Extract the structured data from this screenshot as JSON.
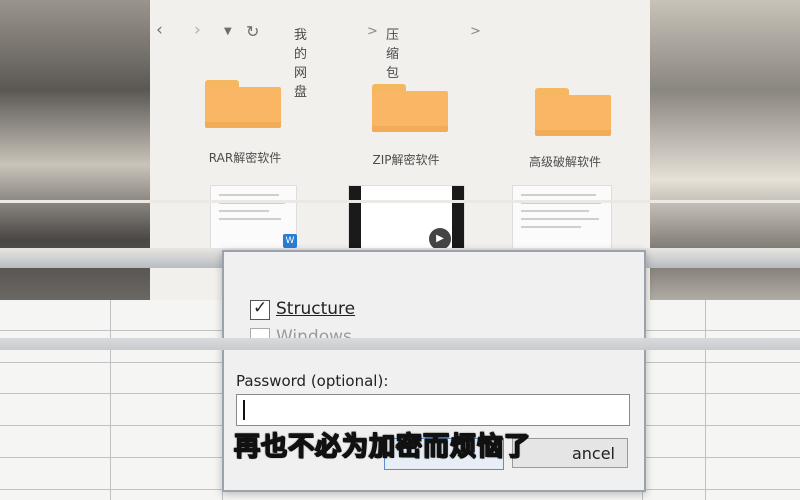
{
  "explorer": {
    "breadcrumb": [
      "我的网盘",
      "压缩包解密"
    ],
    "folders": [
      "RAR解密软件",
      "ZIP解密软件",
      "高级破解软件"
    ]
  },
  "dialog": {
    "structure_label": "Structure",
    "windows_label": "Windows",
    "password_label": "Password (optional):",
    "password_value": "",
    "cancel_label": "ancel"
  },
  "subtitle": "再也不必为加密而烦恼了",
  "colors": {
    "folder": "#f9b765",
    "dialog_bg": "#f0f0f0",
    "subtitle": "#ffffff"
  }
}
